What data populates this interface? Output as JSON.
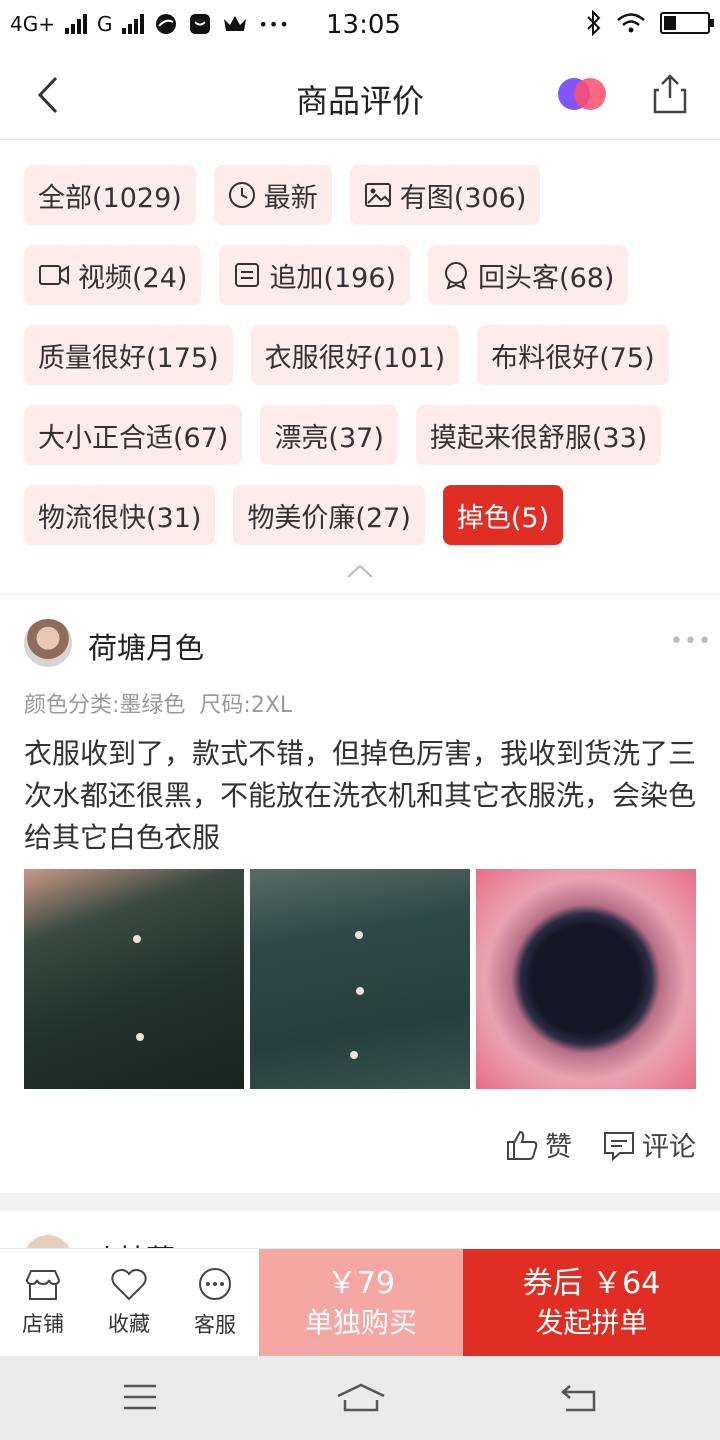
{
  "status": {
    "network": "4G+",
    "network2": "G",
    "time": "13:05",
    "dots": "•••"
  },
  "header": {
    "title": "商品评价"
  },
  "filters": {
    "rows": [
      [
        {
          "label": "全部(1029)",
          "icon": null,
          "active": false
        },
        {
          "label": "最新",
          "icon": "clock-icon",
          "active": false
        },
        {
          "label": "有图(306)",
          "icon": "image-icon",
          "active": false
        }
      ],
      [
        {
          "label": "视频(24)",
          "icon": "video-icon",
          "active": false
        },
        {
          "label": "追加(196)",
          "icon": "note-icon",
          "active": false
        },
        {
          "label": "回头客(68)",
          "icon": "badge-icon",
          "active": false
        }
      ],
      [
        {
          "label": "质量很好(175)",
          "icon": null,
          "active": false
        },
        {
          "label": "衣服很好(101)",
          "icon": null,
          "active": false
        },
        {
          "label": "布料很好(75)",
          "icon": null,
          "active": false
        }
      ],
      [
        {
          "label": "大小正合适(67)",
          "icon": null,
          "active": false
        },
        {
          "label": "漂亮(37)",
          "icon": null,
          "active": false
        },
        {
          "label": "摸起来很舒服(33)",
          "icon": null,
          "active": false
        }
      ],
      [
        {
          "label": "物流很快(31)",
          "icon": null,
          "active": false
        },
        {
          "label": "物美价廉(27)",
          "icon": null,
          "active": false
        },
        {
          "label": "掉色(5)",
          "icon": null,
          "active": true
        }
      ]
    ]
  },
  "review": {
    "username": "荷塘月色",
    "more": "•••",
    "color_spec": "颜色分类:墨绿色",
    "size_spec": "尺码:2XL",
    "content": "衣服收到了，款式不错，但掉色厉害，我收到货洗了三次水都还很黑，不能放在洗衣机和其它衣服洗，会染色给其它白色衣服",
    "like_label": "赞",
    "comment_label": "评论"
  },
  "next_review": {
    "username": "叶林蔓"
  },
  "bottom": {
    "store_label": "店铺",
    "favorite_label": "收藏",
    "service_label": "客服",
    "single_price": "￥79",
    "single_label": "单独购买",
    "group_price": "券后 ￥64",
    "group_label": "发起拼单"
  },
  "colors": {
    "accent": "#e02e24",
    "tag_bg": "#fdecea",
    "single_bg": "#f4a7a3"
  }
}
